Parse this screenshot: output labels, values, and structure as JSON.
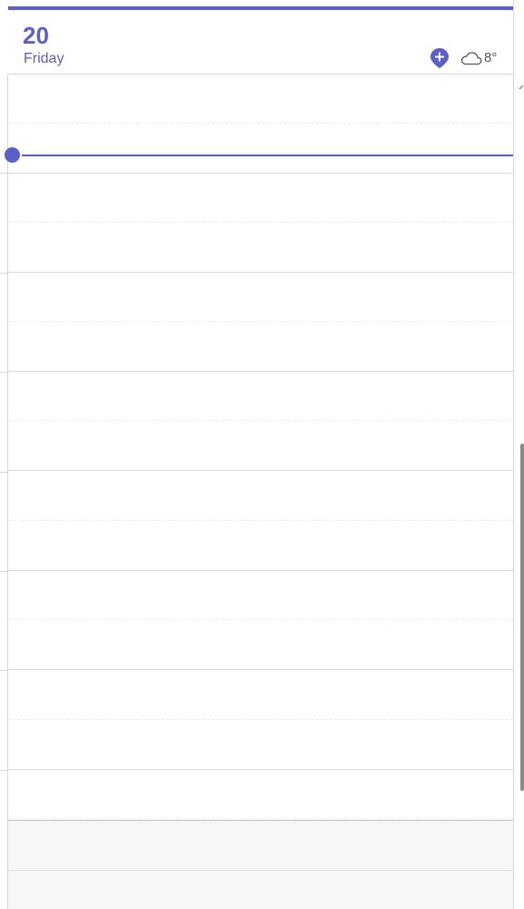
{
  "day_header": {
    "date_number": "20",
    "day_name": "Friday"
  },
  "icons": {
    "add_event": "add-event-pin-icon",
    "weather": "cloud-icon"
  },
  "weather": {
    "temperature": "8°",
    "condition_icon": "cloud-icon"
  },
  "colors": {
    "accent": "#5b5fc7",
    "grid_line": "#d9d9d9",
    "half_hour_line": "#ececec",
    "off_hours_bg": "#f7f7f7"
  }
}
